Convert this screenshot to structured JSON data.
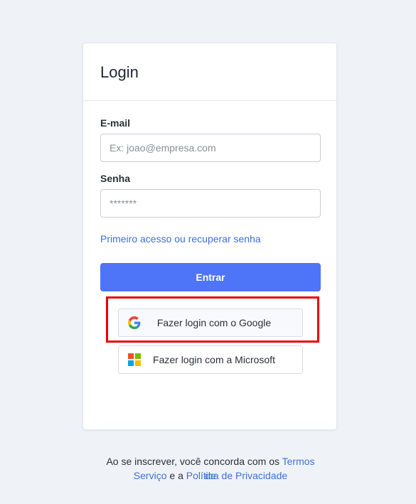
{
  "header": {
    "title": "Login"
  },
  "form": {
    "email_label": "E-mail",
    "email_placeholder": "Ex: joao@empresa.com",
    "email_value": "",
    "password_label": "Senha",
    "password_placeholder": "*******",
    "password_value": "",
    "recover_link": "Primeiro acesso ou recuperar senha",
    "submit_label": "Entrar"
  },
  "social": {
    "google_label": "Fazer login com o Google",
    "google_icon": "google-icon",
    "microsoft_label": "Fazer login com a Microsoft",
    "microsoft_icon": "microsoft-icon"
  },
  "terms": {
    "prefix": "Ao se inscrever, você concorda com os ",
    "terms_link_line1": "Termos de",
    "terms_link_line2": "Serviço",
    "middle": " e a ",
    "privacy_link": "Política de Privacidade"
  },
  "colors": {
    "primary": "#4e74f7",
    "link": "#3f6fd6",
    "highlight": "#e8000b",
    "background": "#eff3f8"
  }
}
